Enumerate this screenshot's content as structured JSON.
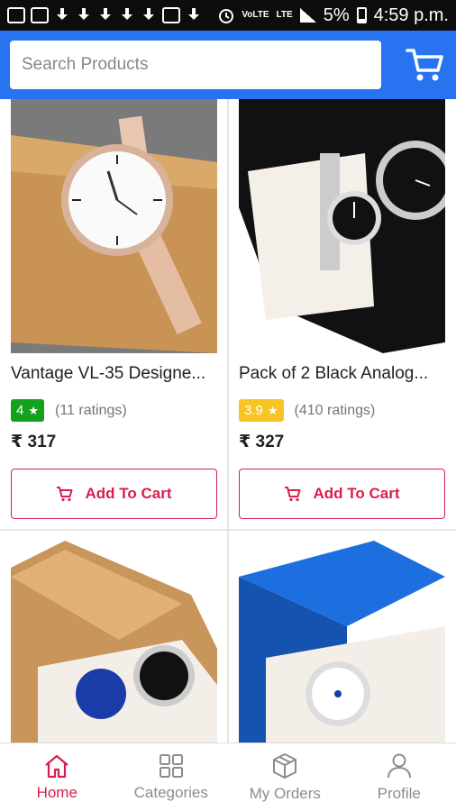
{
  "status_bar": {
    "network_left": "VoLTE",
    "network_right": "LTE",
    "battery": "5%",
    "time": "4:59 p.m."
  },
  "search": {
    "placeholder": "Search Products"
  },
  "products": [
    {
      "name": "Vantage VL-35 Designe...",
      "rating": "4",
      "rating_color": "#14a11e",
      "ratings_count": "(11 ratings)",
      "price": "₹ 317",
      "add_to_cart_label": "Add To Cart"
    },
    {
      "name": "Pack of 2 Black Analog...",
      "rating": "3.9",
      "rating_color": "#f7c325",
      "ratings_count": "(410 ratings)",
      "price": "₹ 327",
      "add_to_cart_label": "Add To Cart"
    }
  ],
  "bottom_nav": [
    {
      "label": "Home",
      "icon": "home-icon",
      "active": true
    },
    {
      "label": "Categories",
      "icon": "grid-icon",
      "active": false
    },
    {
      "label": "My Orders",
      "icon": "box-icon",
      "active": false
    },
    {
      "label": "Profile",
      "icon": "user-icon",
      "active": false
    }
  ],
  "colors": {
    "header": "#2874f0",
    "accent": "#d81e4c",
    "rating_green": "#14a11e",
    "rating_yellow": "#f7c325"
  }
}
